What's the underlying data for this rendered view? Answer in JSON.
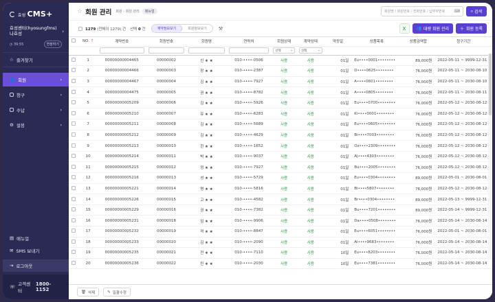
{
  "sidebar": {
    "logo_small": "효성",
    "logo_main": "CMS+",
    "center_name": "효성센터(hyosungfms)",
    "user_name": "나효성",
    "timer": "39:55",
    "extend": "연장하기",
    "favorites": "즐겨찾기",
    "menu": [
      {
        "label": "회원",
        "active": true
      },
      {
        "label": "청구",
        "active": false
      },
      {
        "label": "수납",
        "active": false
      },
      {
        "label": "설정",
        "active": false
      }
    ],
    "manual": "매뉴얼",
    "sms": "SMS 보내기",
    "logout": "로그아웃",
    "cs_label": "고객센터",
    "cs_phone": "1800-1152"
  },
  "header": {
    "title": "회원 관리",
    "crumbs": [
      "회원",
      "회원 관리"
    ],
    "badge": "매뉴얼",
    "search_placeholder": "회원명 / 회원번호 / 전화번호 / 납부자번호",
    "search_button": "검색"
  },
  "toolbar": {
    "total": "1279",
    "total_note": "(전체이 1279) 건",
    "selected": "선택",
    "selected_count": "0",
    "selected_unit": "건",
    "seg_on": "계약정보보기",
    "seg_off": "회원정보보기",
    "bulk_button": "대량 회원 관리",
    "add_button": "회원 등록"
  },
  "table": {
    "columns": [
      "NO.",
      "계약번호",
      "회원번호",
      "회원명",
      "연락처",
      "회원상태",
      "계약상태",
      "약정일",
      "상품목록",
      "상품금액합",
      "청구기간"
    ],
    "filter_select": "선택",
    "rows": [
      {
        "no": "1",
        "contract": "00000000004465",
        "member": "00000002",
        "name": "신 ★ ★",
        "phone": "010-••••-0506",
        "mstat": "사용",
        "cstat": "사용",
        "day": "01일",
        "product": "Eu••••0001••••••••",
        "amount": "89,000원",
        "period": "2022-05-11 ~ 9999-12-31"
      },
      {
        "no": "2",
        "contract": "00000000004466",
        "member": "00000003",
        "name": "장 ★ ★",
        "phone": "010-••••-2387",
        "mstat": "사용",
        "cstat": "사용",
        "day": "01일",
        "product": "D••••0625••••••••",
        "amount": "76,000원",
        "period": "2022-05-11 ~ 2030-08-10"
      },
      {
        "no": "3",
        "contract": "00000000004467",
        "member": "00000004",
        "name": "김 ★ ★",
        "phone": "010-••••-7927",
        "mstat": "사용",
        "cstat": "사용",
        "day": "01일",
        "product": "A••••0601••••••••",
        "amount": "76,000원",
        "period": "2022-05-11 ~ 2030-08-10"
      },
      {
        "no": "4",
        "contract": "00000000004475",
        "member": "00000005",
        "name": "권 ★ ★",
        "phone": "010-••••-8782",
        "mstat": "사용",
        "cstat": "사용",
        "day": "01일",
        "product": "A••••0805••••••••",
        "amount": "76,000원",
        "period": "2022-05-11 ~ 2030-08-11"
      },
      {
        "no": "5",
        "contract": "00000000005209",
        "member": "00000006",
        "name": "김 ★ ★",
        "phone": "010-••••-5926",
        "mstat": "사용",
        "cstat": "사용",
        "day": "01일",
        "product": "Eu••••0700••••••••",
        "amount": "76,000원",
        "period": "2022-05-12 ~ 2030-08-12"
      },
      {
        "no": "6",
        "contract": "00000000005210",
        "member": "00000007",
        "name": "유 ★ ★",
        "phone": "010-••••-6283",
        "mstat": "사용",
        "cstat": "사용",
        "day": "01일",
        "product": "Ki••••0001••••••••",
        "amount": "76,000원",
        "period": "2022-05-12 ~ 2030-08-12"
      },
      {
        "no": "7",
        "contract": "00000000005211",
        "member": "00000008",
        "name": "김 ★ ★",
        "phone": "010-••••-5689",
        "mstat": "사용",
        "cstat": "사용",
        "day": "01일",
        "product": "Eu••••0605••••••••",
        "amount": "76,000원",
        "period": "2022-05-12 ~ 2030-08-12"
      },
      {
        "no": "8",
        "contract": "00000000005212",
        "member": "00000009",
        "name": "김 ★ ★",
        "phone": "010-••••-4629",
        "mstat": "사용",
        "cstat": "사용",
        "day": "01일",
        "product": "Bi••••7003••••••••",
        "amount": "76,000원",
        "period": "2022-05-12 ~ 2030-08-12"
      },
      {
        "no": "9",
        "contract": "00000000005213",
        "member": "00000010",
        "name": "한 ★ ★",
        "phone": "010-••••-1652",
        "mstat": "사용",
        "cstat": "사용",
        "day": "01일",
        "product": "Oz••••2309••••••••",
        "amount": "76,000원",
        "period": "2022-05-12 ~ 2030-08-12"
      },
      {
        "no": "10",
        "contract": "00000000005214",
        "member": "00000011",
        "name": "박 ★ ★",
        "phone": "010-••••-9037",
        "mstat": "사용",
        "cstat": "사용",
        "day": "01일",
        "product": "Aj••••4303••••••••",
        "amount": "76,000원",
        "period": "2022-05-12 ~ 2030-08-12"
      },
      {
        "no": "11",
        "contract": "00000000005215",
        "member": "00000012",
        "name": "정 ★ ★",
        "phone": "010-••••-7927",
        "mstat": "사용",
        "cstat": "사용",
        "day": "01일",
        "product": "Bu••••2005••••••••",
        "amount": "76,000원",
        "period": "2022-05-12 ~ 2030-08-12"
      },
      {
        "no": "12",
        "contract": "00000000005216",
        "member": "00000013",
        "name": "성 ★ ★",
        "phone": "010-••••-5729",
        "mstat": "사용",
        "cstat": "사용",
        "day": "01일",
        "product": "Eu••••0304••••••••",
        "amount": "89,000원",
        "period": "2022-05-01 ~ 2030-08-01"
      },
      {
        "no": "13",
        "contract": "00000000005221",
        "member": "00000014",
        "name": "명 ★ ★",
        "phone": "010-••••-5816",
        "mstat": "사용",
        "cstat": "사용",
        "day": "01일",
        "product": "Bi••••5807••••••••",
        "amount": "76,000원",
        "period": "2022-05-12 ~ 2030-08-12"
      },
      {
        "no": "14",
        "contract": "00000000005226",
        "member": "00000015",
        "name": "고 ★ ★",
        "phone": "010-••••-4582",
        "mstat": "사용",
        "cstat": "사용",
        "day": "01일",
        "product": "Br••••0304••••••••",
        "amount": "89,000원",
        "period": "2022-05-13 ~ 9999-12-31"
      },
      {
        "no": "15",
        "contract": "00000000005229",
        "member": "00000016",
        "name": "권 ★ ★",
        "phone": "010-••••-7382",
        "mstat": "사용",
        "cstat": "사용",
        "day": "01일",
        "product": "Bu••••7201••••••••",
        "amount": "89,000원",
        "period": "2022-05-14 ~ 9999-12-31"
      },
      {
        "no": "16",
        "contract": "00000000005231",
        "member": "00000018",
        "name": "임 ★ ★",
        "phone": "010-••••-9906",
        "mstat": "사용",
        "cstat": "사용",
        "day": "01일",
        "product": "Da••••0508••••••••",
        "amount": "76,000원",
        "period": "2022-05-14 ~ 2030-08-14"
      },
      {
        "no": "17",
        "contract": "00000000005232",
        "member": "00000019",
        "name": "곽 ★ ★",
        "phone": "010-••••-8847",
        "mstat": "사용",
        "cstat": "사용",
        "day": "01일",
        "product": "Eu••••6051••••••••",
        "amount": "76,000원",
        "period": "2022-05-01 ~ 2030-08-01"
      },
      {
        "no": "18",
        "contract": "00000000005233",
        "member": "00000020",
        "name": "김 ★ ★",
        "phone": "010-••••-2090",
        "mstat": "사용",
        "cstat": "사용",
        "day": "01일",
        "product": "Ai••••9683••••••••",
        "amount": "76,000원",
        "period": "2022-05-14 ~ 2030-08-14"
      },
      {
        "no": "19",
        "contract": "00000000005235",
        "member": "00000021",
        "name": "전 ★ ★",
        "phone": "010-••••-7110",
        "mstat": "사용",
        "cstat": "사용",
        "day": "10일",
        "product": "Eu••••8203••••••••",
        "amount": "76,000원",
        "period": "2022-05-14 ~ 2030-08-14"
      },
      {
        "no": "20",
        "contract": "00000000005236",
        "member": "00000022",
        "name": "민 ★ ★",
        "phone": "010-••••-2030",
        "mstat": "사용",
        "cstat": "사용",
        "day": "10일",
        "product": "Eu••••7381••••••••",
        "amount": "76,000원",
        "period": "2022-05-14 ~ 2030-08-14"
      }
    ]
  },
  "footer": {
    "delete_button": "삭제",
    "bulk_edit_button": "일괄수정"
  },
  "colors": {
    "sidebar": "#2b2a55",
    "accent": "#5b3fd1",
    "status_green": "#2e9a4a"
  }
}
